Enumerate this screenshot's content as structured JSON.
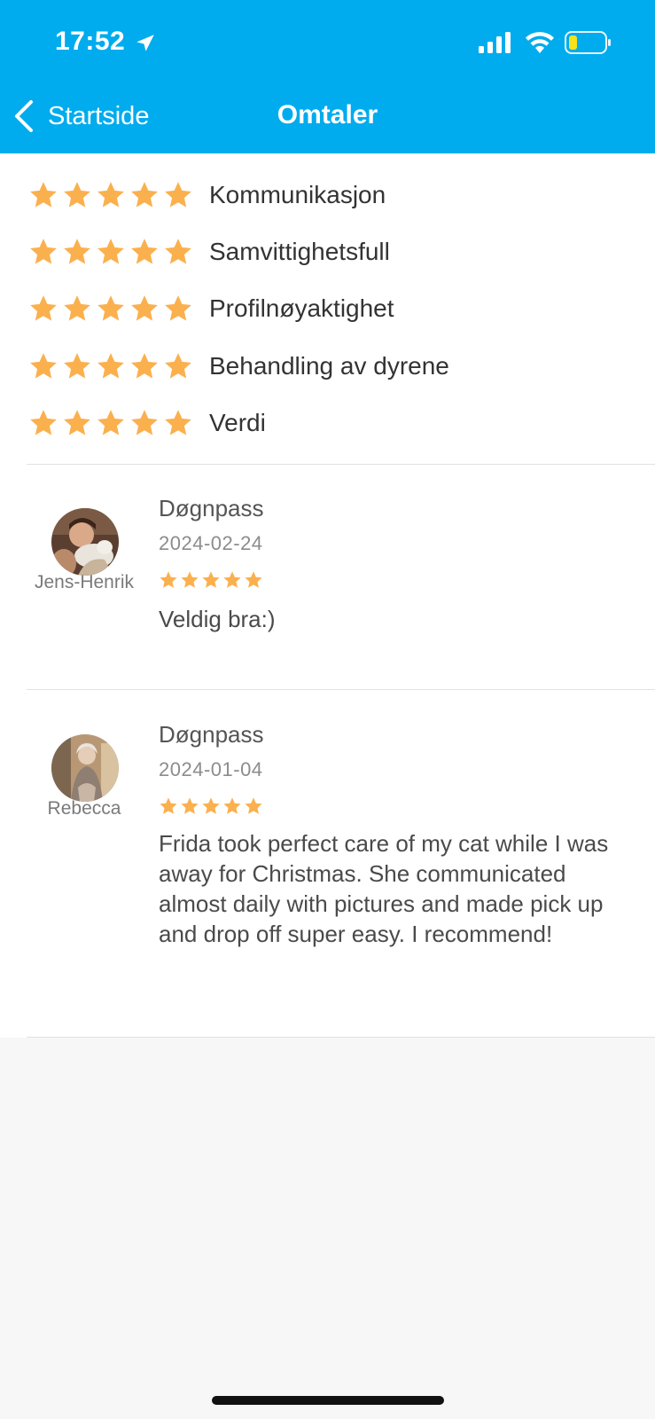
{
  "status_bar": {
    "time": "17:52"
  },
  "nav": {
    "back_label": "Startside",
    "title": "Omtaler"
  },
  "colors": {
    "header": "#00aced",
    "star": "#fbb04e"
  },
  "ratings": [
    {
      "label": "Kommunikasjon",
      "stars": 5
    },
    {
      "label": "Samvittighetsfull",
      "stars": 5
    },
    {
      "label": "Profilnøyaktighet",
      "stars": 5
    },
    {
      "label": "Behandling av dyrene",
      "stars": 5
    },
    {
      "label": "Verdi",
      "stars": 5
    }
  ],
  "reviews": [
    {
      "reviewer": "Jens-Henrik",
      "service": "Døgnpass",
      "date": "2024-02-24",
      "stars": 5,
      "text": "Veldig bra:)"
    },
    {
      "reviewer": "Rebecca",
      "service": "Døgnpass",
      "date": "2024-01-04",
      "stars": 5,
      "text": "Frida took perfect care of my cat while I was away for Christmas. She communicated almost daily with pictures and made pick up and drop off super easy. I recommend!"
    }
  ]
}
